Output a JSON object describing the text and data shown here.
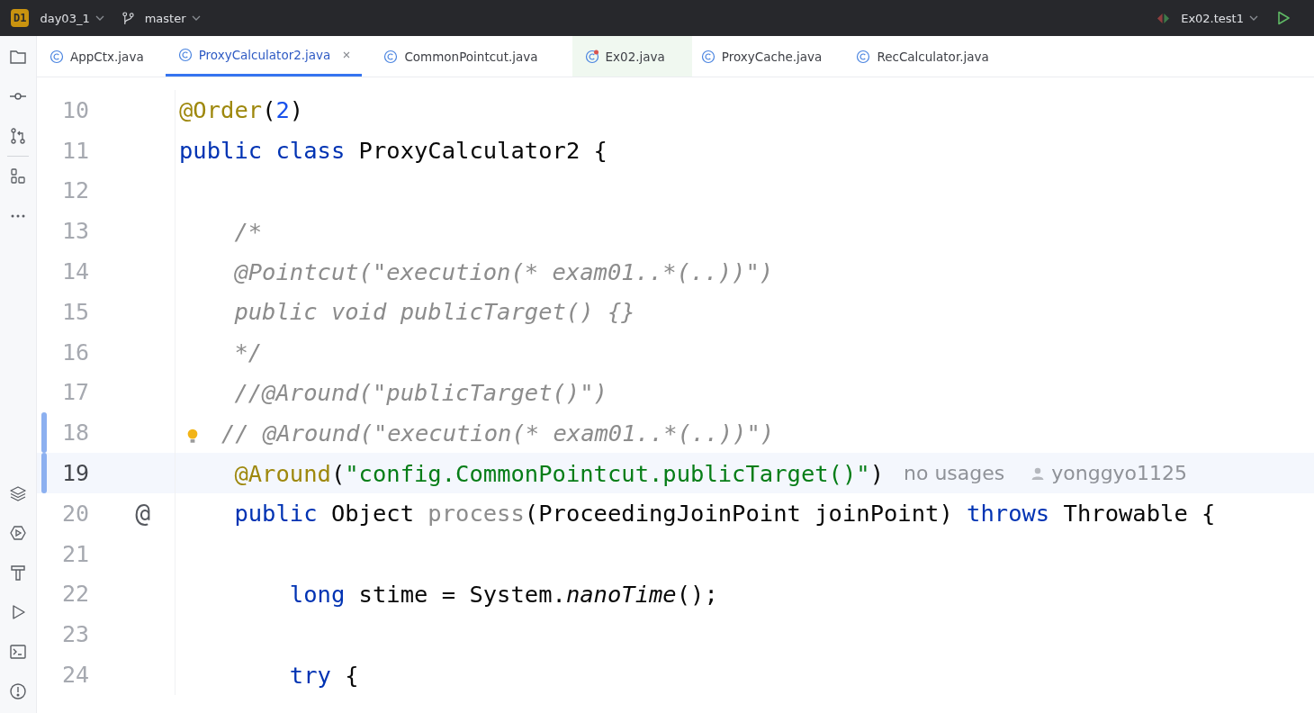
{
  "toolbar": {
    "project_badge": "D1",
    "project": "day03_1",
    "branch": "master",
    "run_config": "Ex02.test1"
  },
  "tabs": [
    {
      "label": "AppCtx.java",
      "selected": false,
      "highlighted": false,
      "marked": false
    },
    {
      "label": "ProxyCalculator2.java",
      "selected": true,
      "highlighted": false,
      "marked": false
    },
    {
      "label": "CommonPointcut.java",
      "selected": false,
      "highlighted": false,
      "marked": false
    },
    {
      "label": "Ex02.java",
      "selected": false,
      "highlighted": true,
      "marked": true
    },
    {
      "label": "ProxyCache.java",
      "selected": false,
      "highlighted": false,
      "marked": false
    },
    {
      "label": "RecCalculator.java",
      "selected": false,
      "highlighted": false,
      "marked": false
    }
  ],
  "lines": [
    {
      "number": "10",
      "current": false,
      "changed": false,
      "bulb": false,
      "tokens": [
        {
          "kind": "annotation",
          "text": "@Order"
        },
        {
          "kind": "plain",
          "text": "("
        },
        {
          "kind": "number",
          "text": "2"
        },
        {
          "kind": "plain",
          "text": ")"
        }
      ]
    },
    {
      "number": "11",
      "current": false,
      "changed": false,
      "bulb": false,
      "tokens": [
        {
          "kind": "keyword",
          "text": "public class "
        },
        {
          "kind": "plain",
          "text": "ProxyCalculator2 {"
        }
      ]
    },
    {
      "number": "12",
      "current": false,
      "changed": false,
      "bulb": false
    },
    {
      "number": "13",
      "current": false,
      "changed": false,
      "bulb": false,
      "tokens": [
        {
          "kind": "comment",
          "text": "    /*"
        }
      ]
    },
    {
      "number": "14",
      "current": false,
      "changed": false,
      "bulb": false,
      "tokens": [
        {
          "kind": "comment",
          "text": "    @Pointcut(\"execution(* exam01..*(..))\")"
        }
      ]
    },
    {
      "number": "15",
      "current": false,
      "changed": false,
      "bulb": false,
      "tokens": [
        {
          "kind": "comment",
          "text": "    public void publicTarget() {}"
        }
      ]
    },
    {
      "number": "16",
      "current": false,
      "changed": false,
      "bulb": false,
      "tokens": [
        {
          "kind": "comment",
          "text": "    */"
        }
      ]
    },
    {
      "number": "17",
      "current": false,
      "changed": false,
      "bulb": false,
      "tokens": [
        {
          "kind": "comment",
          "text": "    //@Around(\"publicTarget()\")"
        }
      ]
    },
    {
      "number": "18",
      "current": false,
      "changed": true,
      "bulb": true,
      "tokens": [
        {
          "kind": "comment",
          "text": "// @Around(\"execution(* exam01..*(..))\")"
        }
      ]
    },
    {
      "number": "19",
      "current": true,
      "changed": true,
      "bulb": false,
      "tokens": [
        {
          "kind": "annotation",
          "text": "    @Around"
        },
        {
          "kind": "plain",
          "text": "("
        },
        {
          "kind": "string",
          "text": "\"config.CommonPointcut.publicTarget()\""
        },
        {
          "kind": "plain",
          "text": ")"
        }
      ],
      "hint": "no usages",
      "author": "yonggyo1125"
    },
    {
      "number": "20",
      "current": false,
      "changed": false,
      "bulb": false,
      "gutter_mark": "@",
      "tokens": [
        {
          "kind": "keyword",
          "text": "    public "
        },
        {
          "kind": "plain",
          "text": "Object "
        },
        {
          "kind": "unused",
          "text": "process"
        },
        {
          "kind": "plain",
          "text": "(ProceedingJoinPoint joinPoint) "
        },
        {
          "kind": "keyword",
          "text": "throws "
        },
        {
          "kind": "plain",
          "text": "Throwable {"
        }
      ]
    },
    {
      "number": "21",
      "current": false,
      "changed": false,
      "bulb": false
    },
    {
      "number": "22",
      "current": false,
      "changed": false,
      "bulb": false,
      "tokens": [
        {
          "kind": "keyword",
          "text": "        long "
        },
        {
          "kind": "plain",
          "text": "stime = System."
        },
        {
          "kind": "static",
          "text": "nanoTime"
        },
        {
          "kind": "plain",
          "text": "();"
        }
      ]
    },
    {
      "number": "23",
      "current": false,
      "changed": false,
      "bulb": false
    },
    {
      "number": "24",
      "current": false,
      "changed": false,
      "bulb": false,
      "tokens": [
        {
          "kind": "keyword",
          "text": "        try "
        },
        {
          "kind": "plain",
          "text": "{"
        }
      ]
    }
  ]
}
